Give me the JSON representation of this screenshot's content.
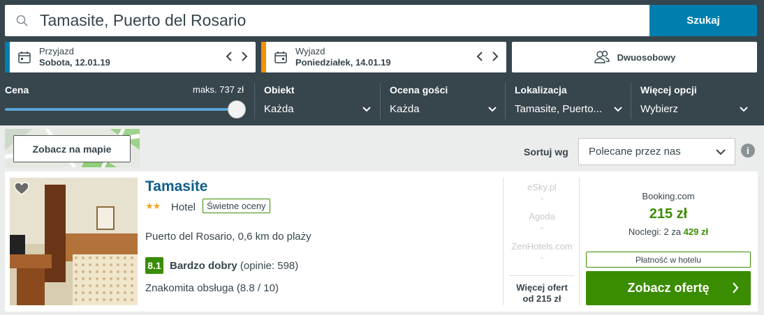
{
  "search": {
    "query": "Tamasite, Puerto del Rosario",
    "button_label": "Szukaj"
  },
  "checkin": {
    "label": "Przyjazd",
    "value": "Sobota, 12.01.19",
    "accent": "#007faf"
  },
  "checkout": {
    "label": "Wyjazd",
    "value": "Poniedziałek, 14.01.19",
    "accent": "#f39200"
  },
  "room": {
    "label": "Dwuosobowy"
  },
  "filters": {
    "price": {
      "label": "Cena",
      "max_label": "maks. 737 zł",
      "level": 1.0
    },
    "property": {
      "label": "Obiekt",
      "value": "Każda"
    },
    "rating": {
      "label": "Ocena gości",
      "value": "Każda"
    },
    "location": {
      "label": "Lokalizacja",
      "value": "Tamasite, Puerto..."
    },
    "more": {
      "label": "Więcej opcji",
      "value": "Wybierz"
    }
  },
  "map": {
    "button_label": "Zobacz na mapie"
  },
  "sort": {
    "label": "Sortuj wg",
    "value": "Polecane przez nas"
  },
  "hotel": {
    "name": "Tamasite",
    "stars": "★★",
    "type": "Hotel",
    "badge": "Świetne oceny",
    "location": "Puerto del Rosario, 0,6 km do plaży",
    "score": "8.1",
    "rating_text": "Bardzo dobry",
    "reviews": "(opinie: 598)",
    "service": "Znakomita obsługa (8.8 / 10)"
  },
  "partners": [
    {
      "name": "eSky.pl",
      "price": "-"
    },
    {
      "name": "Agoda",
      "price": "-"
    },
    {
      "name": "ZenHotels.com",
      "price": "-"
    }
  ],
  "more_offers": {
    "line1": "Więcej ofert",
    "line2": "od 215 zł"
  },
  "deal": {
    "provider": "Booking.com",
    "price": "215 zł",
    "nights_prefix": "Noclegi: 2 za ",
    "nights_total": "429 zł",
    "payment": "Płatność w hotelu",
    "cta": "Zobacz ofertę"
  },
  "colors": {
    "primary": "#007faf",
    "green": "#3a8c00",
    "header": "#37454d"
  }
}
